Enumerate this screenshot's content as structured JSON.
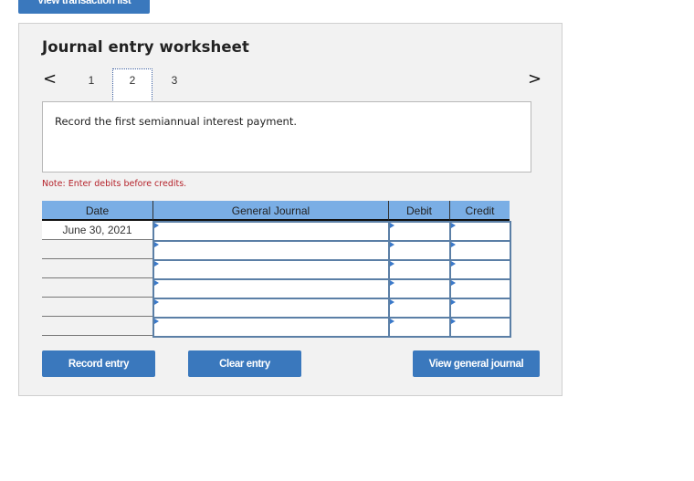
{
  "top_button": {
    "label": "View transaction list"
  },
  "worksheet": {
    "title": "Journal entry worksheet",
    "nav": {
      "prev_icon": "chevron-left-icon",
      "next_icon": "chevron-right-icon",
      "prev_glyph": "<",
      "next_glyph": ">",
      "steps": [
        "1",
        "2",
        "3"
      ],
      "active_step": "2"
    },
    "prompt": "Record the first semiannual interest payment.",
    "note": "Note: Enter debits before credits.",
    "table": {
      "headers": {
        "date": "Date",
        "account": "General Journal",
        "debit": "Debit",
        "credit": "Credit"
      },
      "rows": [
        {
          "date": "June 30, 2021",
          "account": "",
          "debit": "",
          "credit": ""
        },
        {
          "date": "",
          "account": "",
          "debit": "",
          "credit": ""
        },
        {
          "date": "",
          "account": "",
          "debit": "",
          "credit": ""
        },
        {
          "date": "",
          "account": "",
          "debit": "",
          "credit": ""
        },
        {
          "date": "",
          "account": "",
          "debit": "",
          "credit": ""
        },
        {
          "date": "",
          "account": "",
          "debit": "",
          "credit": ""
        }
      ]
    },
    "buttons": {
      "record": "Record entry",
      "clear": "Clear entry",
      "view_journal": "View general journal"
    }
  },
  "colors": {
    "button_bg": "#3a78bd",
    "header_bg": "#7aaee5",
    "note_red": "#b5222a",
    "input_border": "#5b7fa6"
  }
}
